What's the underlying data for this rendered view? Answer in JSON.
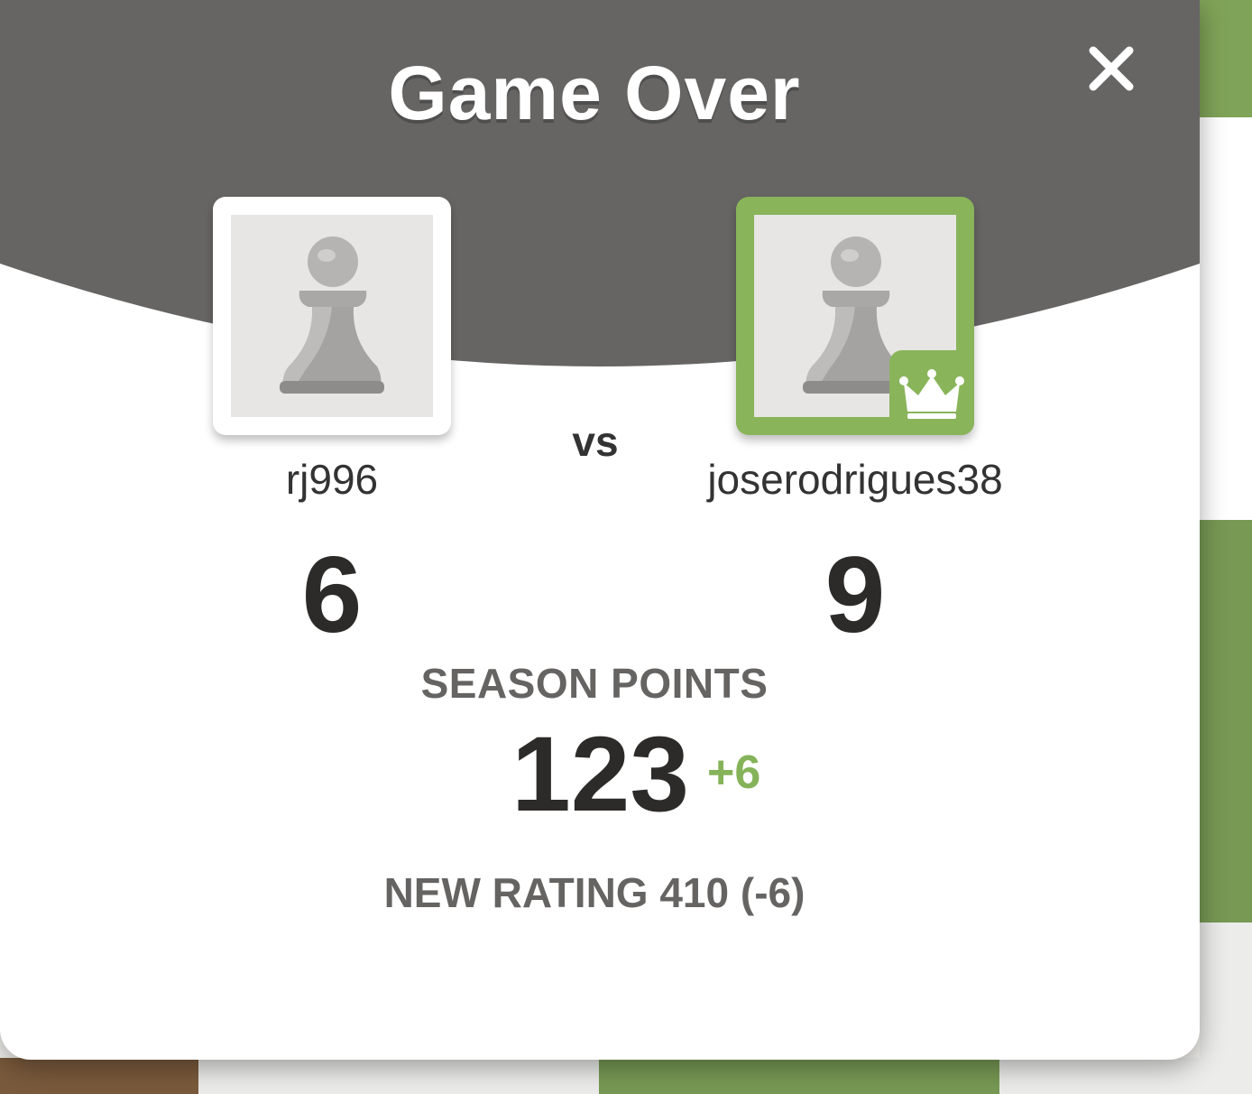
{
  "dialog": {
    "title": "Game Over",
    "close_icon": "close-icon"
  },
  "players": {
    "left": {
      "username": "rj996",
      "score": "6",
      "avatar_icon": "pawn-icon"
    },
    "right": {
      "username": "joserodrigues38",
      "score": "9",
      "avatar_icon": "pawn-icon",
      "winner_badge_icon": "crown-icon"
    }
  },
  "vs_label": "vs",
  "season": {
    "label": "SEASON POINTS",
    "value": "123",
    "delta": "+6"
  },
  "rating_text": "NEW RATING 410 (-6)",
  "colors": {
    "header": "#666564",
    "winner": "#89b45a",
    "delta": "#85b35a"
  }
}
